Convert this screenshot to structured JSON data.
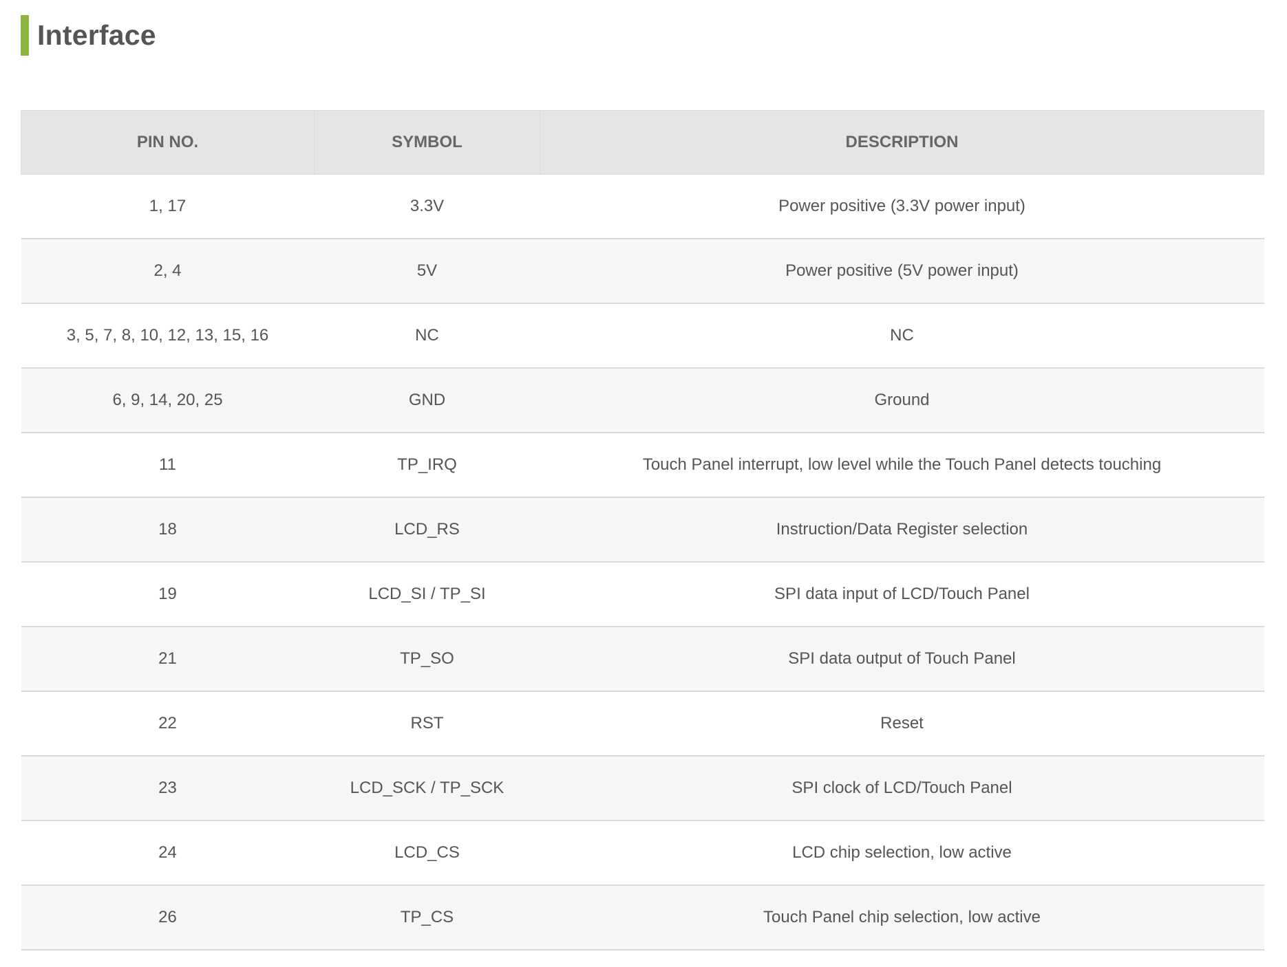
{
  "section": {
    "title": "Interface",
    "accent_color": "#8cb53f"
  },
  "table": {
    "headers": [
      "PIN NO.",
      "SYMBOL",
      "DESCRIPTION"
    ],
    "rows": [
      {
        "pin": "1, 17",
        "symbol": "3.3V",
        "description": "Power positive (3.3V power input)"
      },
      {
        "pin": "2, 4",
        "symbol": "5V",
        "description": "Power positive (5V power input)"
      },
      {
        "pin": "3, 5, 7, 8, 10, 12, 13, 15, 16",
        "symbol": "NC",
        "description": "NC"
      },
      {
        "pin": "6, 9, 14, 20, 25",
        "symbol": "GND",
        "description": "Ground"
      },
      {
        "pin": "11",
        "symbol": "TP_IRQ",
        "description": "Touch Panel interrupt, low level while the Touch Panel detects touching"
      },
      {
        "pin": "18",
        "symbol": "LCD_RS",
        "description": "Instruction/Data Register selection"
      },
      {
        "pin": "19",
        "symbol": "LCD_SI / TP_SI",
        "description": "SPI data input of LCD/Touch Panel"
      },
      {
        "pin": "21",
        "symbol": "TP_SO",
        "description": "SPI data output of Touch Panel"
      },
      {
        "pin": "22",
        "symbol": "RST",
        "description": "Reset"
      },
      {
        "pin": "23",
        "symbol": "LCD_SCK / TP_SCK",
        "description": "SPI clock of LCD/Touch Panel"
      },
      {
        "pin": "24",
        "symbol": "LCD_CS",
        "description": "LCD chip selection, low active"
      },
      {
        "pin": "26",
        "symbol": "TP_CS",
        "description": "Touch Panel chip selection, low active"
      }
    ]
  }
}
